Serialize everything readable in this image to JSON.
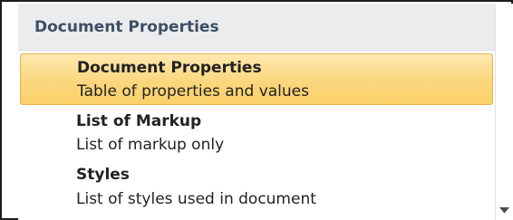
{
  "gallery": {
    "group_header": "Document Properties",
    "items": [
      {
        "title": "Document Properties",
        "description": "Table of properties and values",
        "selected": true
      },
      {
        "title": "List of Markup",
        "description": "List of markup only",
        "selected": false
      },
      {
        "title": "Styles",
        "description": "List of styles used in document",
        "selected": false
      }
    ]
  },
  "scrollbar": {
    "down_icon": "chevron-down-icon"
  },
  "colors": {
    "selected_fill": "#fbd67e",
    "selected_border": "#e8b04c",
    "header_fill": "#ebeced",
    "header_text": "#3e4f64"
  }
}
